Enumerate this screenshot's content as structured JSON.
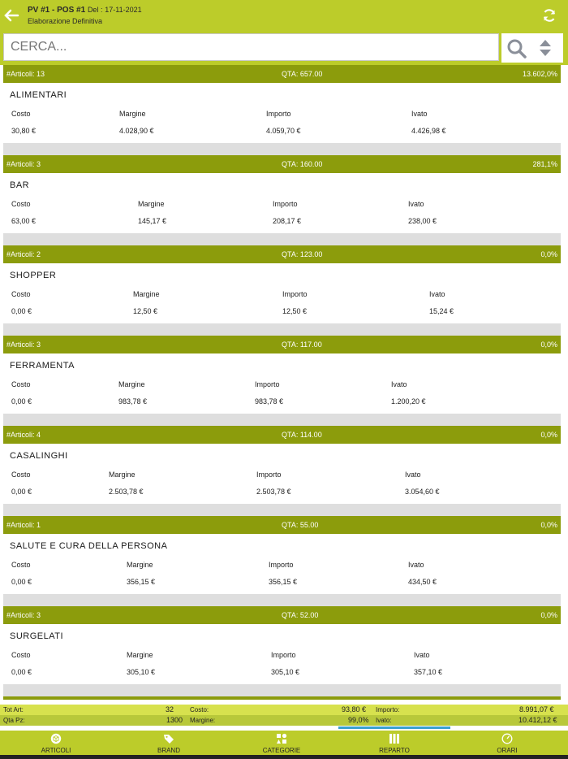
{
  "header": {
    "title": "PV #1 - POS #1",
    "date_prefix": "Del :",
    "date": "17-11-2021",
    "subtitle": "Elaborazione Definitiva"
  },
  "search": {
    "placeholder": "CERCA..."
  },
  "icons": {
    "back": "arrow-left-icon",
    "refresh": "refresh-icon",
    "search": "search-icon",
    "sort": "sort-icon"
  },
  "colors": {
    "header_bg": "#bccc2a",
    "group_bar": "#8c9c0c",
    "active_tab": "#3aa0d0"
  },
  "groups": [
    {
      "count": "#Articoli: 13",
      "qta": "QTA: 657.00",
      "pct": "13.602,0%",
      "name": "ALIMENTARI",
      "labels": [
        "Costo",
        "Margine",
        "Importo",
        "Ivato"
      ],
      "values": [
        "30,80 €",
        "4.028,90 €",
        "4.059,70 €",
        "4.426,98 €"
      ]
    },
    {
      "count": "#Articoli: 3",
      "qta": "QTA: 160.00",
      "pct": "281,1%",
      "name": "BAR",
      "labels": [
        "Costo",
        "Margine",
        "Importo",
        "Ivato"
      ],
      "values": [
        "63,00 €",
        "145,17 €",
        "208,17 €",
        "238,00 €"
      ]
    },
    {
      "count": "#Articoli: 2",
      "qta": "QTA: 123.00",
      "pct": "0,0%",
      "name": "SHOPPER",
      "labels": [
        "Costo",
        "Margine",
        "Importo",
        "Ivato"
      ],
      "values": [
        "0,00 €",
        "12,50 €",
        "12,50 €",
        "15,24 €"
      ]
    },
    {
      "count": "#Articoli: 3",
      "qta": "QTA: 117.00",
      "pct": "0,0%",
      "name": "FERRAMENTA",
      "labels": [
        "Costo",
        "Margine",
        "Importo",
        "Ivato"
      ],
      "values": [
        "0,00 €",
        "983,78 €",
        "983,78 €",
        "1.200,20 €"
      ]
    },
    {
      "count": "#Articoli: 4",
      "qta": "QTA: 114.00",
      "pct": "0,0%",
      "name": "CASALINGHI",
      "labels": [
        "Costo",
        "Margine",
        "Importo",
        "Ivato"
      ],
      "values": [
        "0,00 €",
        "2.503,78 €",
        "2.503,78 €",
        "3.054,60 €"
      ]
    },
    {
      "count": "#Articoli: 1",
      "qta": "QTA: 55.00",
      "pct": "0,0%",
      "name": "SALUTE E CURA DELLA PERSONA",
      "labels": [
        "Costo",
        "Margine",
        "Importo",
        "Ivato"
      ],
      "values": [
        "0,00 €",
        "356,15 €",
        "356,15 €",
        "434,50 €"
      ]
    },
    {
      "count": "#Articoli: 3",
      "qta": "QTA: 52.00",
      "pct": "0,0%",
      "name": "SURGELATI",
      "labels": [
        "Costo",
        "Margine",
        "Importo",
        "Ivato"
      ],
      "values": [
        "0,00 €",
        "305,10 €",
        "305,10 €",
        "357,10 €"
      ]
    }
  ],
  "totals": {
    "tot_art_label": "Tot Art:",
    "tot_art": "32",
    "costo_label": "Costo:",
    "costo": "93,80 €",
    "importo_label": "Importo:",
    "importo": "8.991,07 €",
    "qta_label": "Qta Pz:",
    "qta": "1300",
    "margine_label": "Margine:",
    "margine": "99,0%",
    "ivato_label": "Ivato:",
    "ivato": "10.412,12 €"
  },
  "tabs": [
    {
      "label": "ARTICOLI",
      "icon": "box-icon"
    },
    {
      "label": "BRAND",
      "icon": "tag-icon"
    },
    {
      "label": "CATEGORIE",
      "icon": "categories-icon"
    },
    {
      "label": "REPARTO",
      "icon": "columns-icon"
    },
    {
      "label": "ORARI",
      "icon": "clock-icon"
    }
  ],
  "active_tab": "REPARTO"
}
